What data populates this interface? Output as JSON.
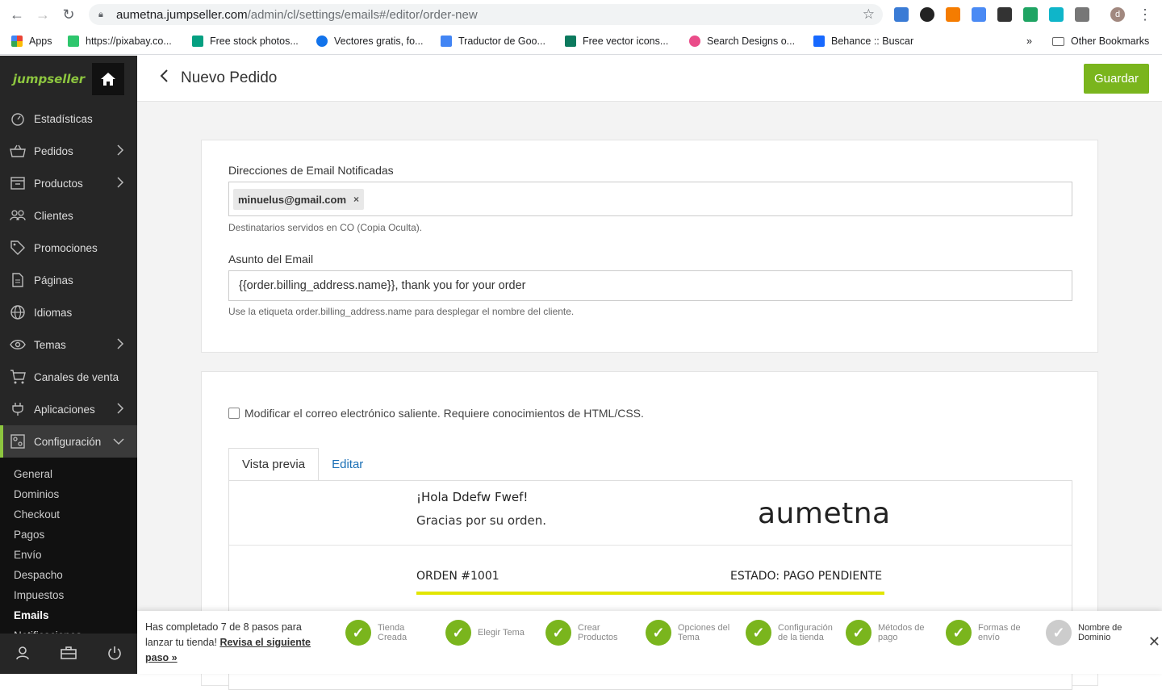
{
  "browser": {
    "url_host": "aumetna.jumpseller.com",
    "url_path": "/admin/cl/settings/emails#/editor/order-new",
    "bookmarks": [
      {
        "label": "Apps",
        "color": "#4285f4"
      },
      {
        "label": "https://pixabay.co...",
        "color": "#2ec66d"
      },
      {
        "label": "Free stock photos...",
        "color": "#05a081"
      },
      {
        "label": "Vectores gratis, fo...",
        "color": "#1273eb"
      },
      {
        "label": "Traductor de Goo...",
        "color": "#4285f4"
      },
      {
        "label": "Free vector icons...",
        "color": "#0c7a5e"
      },
      {
        "label": "Search Designs o...",
        "color": "#ea4c89"
      },
      {
        "label": "Behance :: Buscar",
        "color": "#1769ff"
      }
    ],
    "other_bookmarks": "Other Bookmarks",
    "more": "»"
  },
  "sidebar": {
    "logo": "jumpseller",
    "items": [
      {
        "label": "Estadísticas",
        "icon": "gauge-icon",
        "has_sub": false
      },
      {
        "label": "Pedidos",
        "icon": "basket-icon",
        "has_sub": true
      },
      {
        "label": "Productos",
        "icon": "box-icon",
        "has_sub": true
      },
      {
        "label": "Clientes",
        "icon": "users-icon",
        "has_sub": false
      },
      {
        "label": "Promociones",
        "icon": "tag-icon",
        "has_sub": false
      },
      {
        "label": "Páginas",
        "icon": "page-icon",
        "has_sub": false
      },
      {
        "label": "Idiomas",
        "icon": "globe-icon",
        "has_sub": false
      },
      {
        "label": "Temas",
        "icon": "eye-icon",
        "has_sub": true
      },
      {
        "label": "Canales de venta",
        "icon": "cart-icon",
        "has_sub": false
      },
      {
        "label": "Aplicaciones",
        "icon": "plug-icon",
        "has_sub": true
      },
      {
        "label": "Configuración",
        "icon": "settings-icon",
        "has_sub": true
      }
    ],
    "submenu": [
      "General",
      "Dominios",
      "Checkout",
      "Pagos",
      "Envío",
      "Despacho",
      "Impuestos",
      "Emails",
      "Notificaciones"
    ],
    "active_sub": "Emails"
  },
  "header": {
    "title": "Nuevo Pedido",
    "save_label": "Guardar"
  },
  "form": {
    "emails_label": "Direcciones de Email Notificadas",
    "email_chip": "minuelus@gmail.com",
    "chip_remove": "×",
    "emails_help": "Destinatarios servidos en CO (Copia Oculta).",
    "subject_label": "Asunto del Email",
    "subject_value": "{{order.billing_address.name}}, thank you for your order",
    "subject_help": "Use la etiqueta order.billing_address.name para desplegar el nombre del cliente.",
    "modify_label": "Modificar el correo electrónico saliente. Requiere conocimientos de HTML/CSS.",
    "modify_checked": false
  },
  "tabs": [
    {
      "label": "Vista previa",
      "active": true
    },
    {
      "label": "Editar",
      "active": false
    }
  ],
  "preview": {
    "greeting": "¡Hola Ddefw Fwef!",
    "thanks": "Gracias por su orden.",
    "brand": "aumetna",
    "order_number": "ORDEN #1001",
    "order_status": "ESTADO: PAGO PENDIENTE"
  },
  "progress": {
    "text": "Has completado 7 de 8 pasos para lanzar tu tienda!",
    "link": "Revisa el siguiente paso »",
    "completed": 7,
    "total": 8,
    "steps": [
      {
        "label": "Tienda Creada",
        "done": true
      },
      {
        "label": "Elegir Tema",
        "done": true
      },
      {
        "label": "Crear Productos",
        "done": true
      },
      {
        "label": "Opciones del Tema",
        "done": true
      },
      {
        "label": "Configuración de la tienda",
        "done": true
      },
      {
        "label": "Métodos de pago",
        "done": true
      },
      {
        "label": "Formas de envío",
        "done": true
      },
      {
        "label": "Nombre de Dominio",
        "done": false
      }
    ],
    "close": "✕"
  },
  "colors": {
    "accent": "#7ab51d",
    "sidebar": "#262626",
    "link": "#1a6fb5",
    "preview_line": "#e2e600"
  }
}
